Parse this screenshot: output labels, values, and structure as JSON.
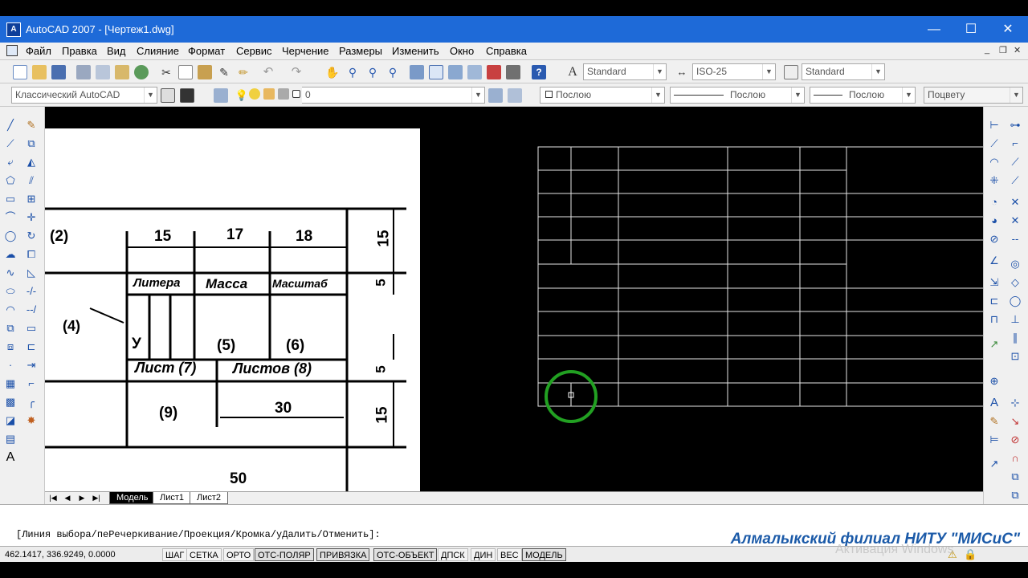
{
  "window": {
    "title": "AutoCAD 2007 - [Чертеж1.dwg]",
    "app_icon": "autocad-icon",
    "controls": [
      "—",
      "☐",
      "✕"
    ]
  },
  "menu": {
    "items": [
      "Файл",
      "Правка",
      "Вид",
      "Слияние",
      "Формат",
      "Сервис",
      "Черчение",
      "Размеры",
      "Изменить",
      "Окно",
      "Справка"
    ]
  },
  "toolbar1": {
    "text_style": "Standard",
    "dim_style": "ISO-25",
    "table_style": "Standard"
  },
  "toolbar2": {
    "workspace": "Классический AutoCAD",
    "layer": "0",
    "color": "Послою",
    "linetype": "Послою",
    "lineweight": "Послою",
    "plotstyle": "Поцвету"
  },
  "tabs": {
    "items": [
      "Модель",
      "Лист1",
      "Лист2"
    ],
    "active": "Модель"
  },
  "command": {
    "prompt": "[Линия выбора/пеРечеркивание/Проекция/Кромка/уДалить/Отменить]:",
    "watermark": "Алмалыкский филиал НИТУ \"МИСиС\""
  },
  "status": {
    "coords": "462.1417, 336.9249, 0.0000",
    "buttons": [
      "ШАГ",
      "СЕТКА",
      "ОРТО",
      "ОТС-ПОЛЯР",
      "ПРИВЯЗКА",
      "ОТС-ОБЪЕКТ",
      "ДПСК",
      "ДИН",
      "ВЕС",
      "МОДЕЛЬ"
    ],
    "activation": "Активация Windows"
  },
  "reference": {
    "labels": [
      "(2)",
      "15",
      "17",
      "18",
      "15",
      "Литера",
      "Масса",
      "Масштаб",
      "5",
      "(4)",
      "У",
      "(5)",
      "(6)",
      "Лист (7)",
      "Листов (8)",
      "5",
      "(9)",
      "30",
      "15",
      "50"
    ]
  },
  "colors": {
    "titlebar": "#1e6ad8",
    "canvas": "#000000",
    "accent": "#1b5aa8",
    "cursor_circle": "#22a022"
  }
}
